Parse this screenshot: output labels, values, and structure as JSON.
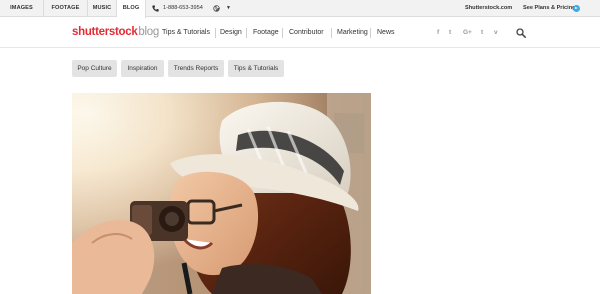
{
  "topbar": {
    "tabs": [
      {
        "label": "IMAGES"
      },
      {
        "label": "FOOTAGE"
      },
      {
        "label": "MUSIC"
      },
      {
        "label": "BLOG"
      }
    ],
    "phone": "1-888-653-3954",
    "site_link": "Shutterstock.com",
    "plans_link": "See Plans & Pricing"
  },
  "header": {
    "logo_brand": "shutterstock",
    "logo_suffix": "blog",
    "nav": [
      {
        "label": "Tips & Tutorials"
      },
      {
        "label": "Design"
      },
      {
        "label": "Footage"
      },
      {
        "label": "Contributor"
      },
      {
        "label": "Marketing"
      },
      {
        "label": "News"
      }
    ],
    "social": [
      {
        "icon": "facebook-icon",
        "glyph": "f"
      },
      {
        "icon": "twitter-icon",
        "glyph": "t"
      },
      {
        "icon": "google-plus-icon",
        "glyph": "G+"
      },
      {
        "icon": "tumblr-icon",
        "glyph": "t"
      },
      {
        "icon": "vimeo-icon",
        "glyph": "v"
      }
    ]
  },
  "tags": [
    {
      "label": "Pop Culture"
    },
    {
      "label": "Inspiration"
    },
    {
      "label": "Trends Reports"
    },
    {
      "label": "Tips & Tutorials"
    }
  ],
  "colors": {
    "brand_red": "#e12c36",
    "accent_blue": "#3fa9e0",
    "tag_bg": "#e3e3e3"
  }
}
